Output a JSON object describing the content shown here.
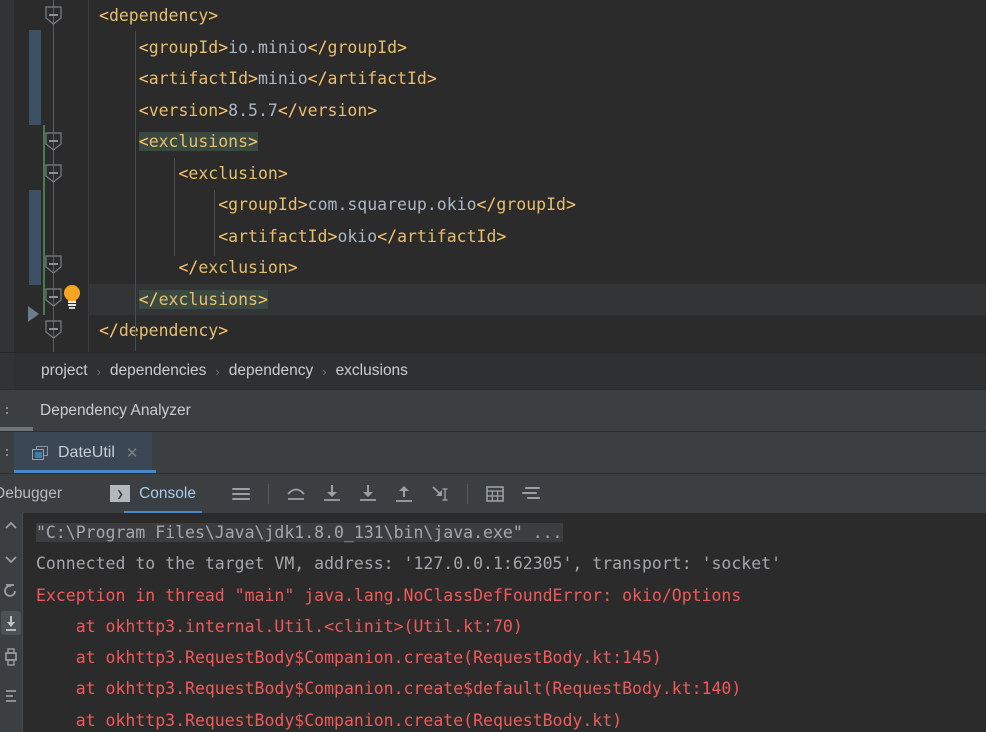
{
  "editor": {
    "language": "xml",
    "lines": [
      {
        "indent": 0,
        "segments": [
          {
            "t": "tag",
            "v": "<dependency>"
          }
        ]
      },
      {
        "indent": 1,
        "segments": [
          {
            "t": "tag",
            "v": "<groupId>"
          },
          {
            "t": "txt",
            "v": "io.minio"
          },
          {
            "t": "tag",
            "v": "</groupId>"
          }
        ]
      },
      {
        "indent": 1,
        "segments": [
          {
            "t": "tag",
            "v": "<artifactId>"
          },
          {
            "t": "txt",
            "v": "minio"
          },
          {
            "t": "tag",
            "v": "</artifactId>"
          }
        ]
      },
      {
        "indent": 1,
        "segments": [
          {
            "t": "tag",
            "v": "<version>"
          },
          {
            "t": "txt",
            "v": "8.5.7"
          },
          {
            "t": "tag",
            "v": "</version>"
          }
        ]
      },
      {
        "indent": 1,
        "highlight": true,
        "segments": [
          {
            "t": "tag",
            "v": "<exclusions>"
          }
        ]
      },
      {
        "indent": 2,
        "segments": [
          {
            "t": "tag",
            "v": "<exclusion>"
          }
        ]
      },
      {
        "indent": 3,
        "segments": [
          {
            "t": "tag",
            "v": "<groupId>"
          },
          {
            "t": "txt",
            "v": "com.squareup.okio"
          },
          {
            "t": "tag",
            "v": "</groupId>"
          }
        ]
      },
      {
        "indent": 3,
        "segments": [
          {
            "t": "tag",
            "v": "<artifactId>"
          },
          {
            "t": "txt",
            "v": "okio"
          },
          {
            "t": "tag",
            "v": "</artifactId>"
          }
        ]
      },
      {
        "indent": 2,
        "segments": [
          {
            "t": "tag",
            "v": "</exclusion>"
          }
        ]
      },
      {
        "indent": 1,
        "highlight": true,
        "caret": true,
        "segments": [
          {
            "t": "tag",
            "v": "</exclusions>"
          }
        ]
      },
      {
        "indent": 0,
        "segments": [
          {
            "t": "tag",
            "v": "</dependency>"
          }
        ]
      }
    ],
    "colors": {
      "background": "#2b2b2b",
      "tag": "#e8bf6a",
      "text_value": "#a9b7c6",
      "matching_tag_highlight": "#3a4a43",
      "caret_line": "#323436",
      "bracket": "#ffc66d"
    },
    "gutter": {
      "intention_bulb_icon": "lightbulb-icon",
      "run_marker_icon": "run-triangle-icon",
      "fold_marker_icon": "fold-collapse-icon"
    }
  },
  "breadcrumbs": {
    "separator": "›",
    "items": [
      "project",
      "dependencies",
      "dependency",
      "exclusions"
    ]
  },
  "dependency_analyzer": {
    "title": "Dependency Analyzer",
    "strip_label": ":"
  },
  "editor_tabs": {
    "strip_label": ":",
    "tabs": [
      {
        "label": "DateUtil",
        "icon": "xml-file-icon",
        "close_icon": "✕",
        "selected": true
      }
    ]
  },
  "debug_toolbar": {
    "tabs": [
      {
        "label": "Debugger",
        "active": false
      },
      {
        "label": "Console",
        "active": true,
        "icon": "console-icon",
        "icon_glyph": "❯"
      }
    ],
    "buttons": [
      {
        "name": "soft-wrap-icon",
        "title": "Soft-Wrap"
      },
      {
        "name": "step-over-icon",
        "title": "Step Over"
      },
      {
        "name": "step-into-icon",
        "title": "Step Into"
      },
      {
        "name": "force-step-into-icon",
        "title": "Force Step Into"
      },
      {
        "name": "step-out-icon",
        "title": "Step Out"
      },
      {
        "name": "run-to-cursor-icon",
        "title": "Run to Cursor"
      },
      {
        "name": "evaluate-expression-icon",
        "title": "Evaluate Expression"
      },
      {
        "name": "settings-list-icon",
        "title": "Settings"
      }
    ]
  },
  "console": {
    "lines": [
      {
        "style": "gray",
        "highlighted": true,
        "text": "\"C:\\Program Files\\Java\\jdk1.8.0_131\\bin\\java.exe\" ..."
      },
      {
        "style": "gray",
        "text": "Connected to the target VM, address: '127.0.0.1:62305', transport: 'socket'"
      },
      {
        "style": "red",
        "text": "Exception in thread \"main\" java.lang.NoClassDefFoundError: okio/Options"
      },
      {
        "style": "red",
        "text": "    at okhttp3.internal.Util.<clinit>(Util.kt:70)"
      },
      {
        "style": "red",
        "text": "    at okhttp3.RequestBody$Companion.create(RequestBody.kt:145)"
      },
      {
        "style": "red",
        "text": "    at okhttp3.RequestBody$Companion.create$default(RequestBody.kt:140)"
      },
      {
        "style": "red",
        "text": "    at okhttp3.RequestBody$Companion.create(RequestBody.kt)"
      }
    ],
    "colors": {
      "gray": "#a4a8ab",
      "red": "#f05a5a",
      "highlight_bg": "#3b3d3f"
    },
    "side_buttons": [
      {
        "name": "scroll-up-icon"
      },
      {
        "name": "scroll-down-icon"
      },
      {
        "name": "rerun-icon"
      },
      {
        "name": "scroll-to-end-icon",
        "selected": true
      },
      {
        "name": "print-icon"
      },
      {
        "name": "wrap-icon"
      }
    ]
  }
}
